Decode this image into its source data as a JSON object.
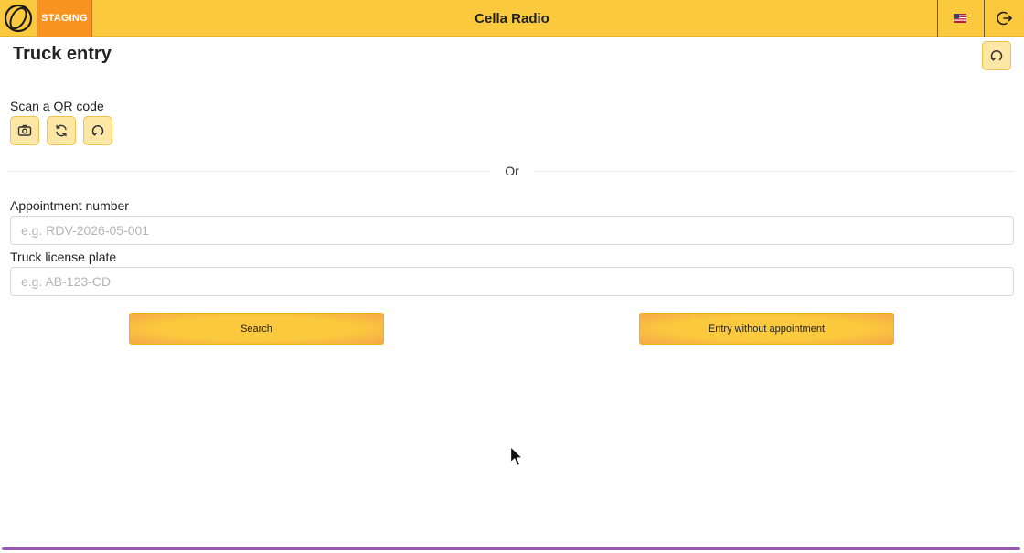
{
  "header": {
    "app_title": "Cella Radio",
    "env_badge": "STAGING",
    "logo_icon": "orbit-logo-icon",
    "language_icon": "us-flag-icon",
    "logout_icon": "logout-icon"
  },
  "page": {
    "title": "Truck entry",
    "refresh_icon": "refresh-icon"
  },
  "scan": {
    "label": "Scan a QR code",
    "buttons": [
      {
        "icon": "camera-icon"
      },
      {
        "icon": "switch-camera-icon"
      },
      {
        "icon": "reset-icon"
      }
    ]
  },
  "divider": {
    "text": "Or"
  },
  "form": {
    "appointment": {
      "label": "Appointment number",
      "placeholder": "e.g. RDV-2026-05-001",
      "value": ""
    },
    "plate": {
      "label": "Truck license plate",
      "placeholder": "e.g. AB-123-CD",
      "value": ""
    },
    "search_label": "Search",
    "no_appointment_label": "Entry without appointment"
  },
  "colors": {
    "primary": "#fbc93d",
    "badge": "#f7931e",
    "progress": "#9b59b6"
  }
}
